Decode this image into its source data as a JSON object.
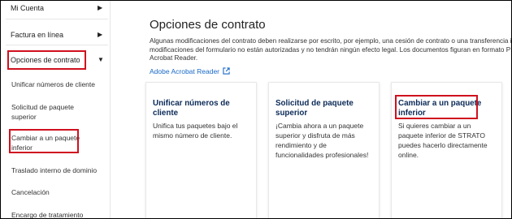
{
  "sidebar": {
    "top_items": [
      {
        "label": "Mi Cuenta",
        "icon": "chevron-right-icon"
      },
      {
        "label": "Factura en línea",
        "icon": "chevron-right-icon"
      },
      {
        "label": "Opciones de contrato",
        "icon": "chevron-down-icon"
      }
    ],
    "sub_items": [
      {
        "lines": [
          "Unificar números de cliente"
        ]
      },
      {
        "lines": [
          "Solicitud de paquete",
          "superior"
        ]
      },
      {
        "lines": [
          "Cambiar a un paquete",
          "inferior"
        ]
      },
      {
        "lines": [
          "Traslado interno de dominio"
        ]
      },
      {
        "lines": [
          "Cancelación"
        ]
      },
      {
        "lines": [
          "Encargo de tratamiento"
        ]
      }
    ]
  },
  "main": {
    "title": "Opciones de contrato",
    "description_lines": [
      "Algunas modificaciones del contrato deben realizarse por escrito, por ejemplo, una cesión de contrato o una transferencia in",
      "modificaciones del formulario no están autorizadas y no tendrán ningún efecto legal. Los documentos figuran en formato PD",
      "Acrobat Reader."
    ],
    "link_label": "Adobe Acrobat Reader",
    "link_icon": "external-link-icon",
    "cards": [
      {
        "title_lines": [
          "Unificar números de",
          "cliente"
        ],
        "text_lines": [
          "Unifica tus paquetes bajo el",
          "mismo número de cliente."
        ]
      },
      {
        "title_lines": [
          "Solicitud de paquete",
          "superior"
        ],
        "text_lines": [
          "¡Cambia ahora a un paquete",
          "superior y disfruta de más",
          "rendimiento y de",
          "funcionalidades profesionales!"
        ]
      },
      {
        "title_lines": [
          "Cambiar a un paquete",
          "inferior"
        ],
        "text_lines": [
          "Si quieres cambiar a un",
          "paquete inferior de STRATO",
          "puedes hacerlo directamente",
          "online."
        ]
      }
    ]
  },
  "colors": {
    "highlight": "#d0101e",
    "link": "#1868c8",
    "card_title": "#0b2a57"
  }
}
